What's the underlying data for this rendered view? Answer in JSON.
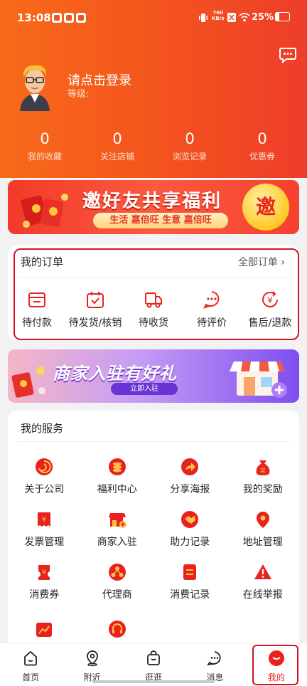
{
  "status": {
    "time": "13:08",
    "net_speed_top": "760",
    "net_speed_bottom": "KB/s",
    "battery": "25%"
  },
  "profile": {
    "login_text": "请点击登录",
    "level_label": "等级:"
  },
  "stats": [
    {
      "value": "0",
      "label": "我的收藏"
    },
    {
      "value": "0",
      "label": "关注店铺"
    },
    {
      "value": "0",
      "label": "浏览记录"
    },
    {
      "value": "0",
      "label": "优惠券"
    }
  ],
  "banner_invite": {
    "title": "邀好友共享福利",
    "subtitle": "生活 嘉倍旺  生意 嘉倍旺",
    "badge": "邀"
  },
  "orders": {
    "title": "我的订单",
    "all_label": "全部订单",
    "items": [
      {
        "label": "待付款",
        "icon": "wallet-icon"
      },
      {
        "label": "待发货/核销",
        "icon": "calendar-check-icon"
      },
      {
        "label": "待收货",
        "icon": "truck-icon"
      },
      {
        "label": "待评价",
        "icon": "chat-bubble-icon"
      },
      {
        "label": "售后/退款",
        "icon": "yen-refund-icon"
      }
    ]
  },
  "banner_merchant": {
    "title": "商家入驻有好礼",
    "button": "立即入驻"
  },
  "services": {
    "title": "我的服务",
    "items": [
      {
        "label": "关于公司",
        "icon": "swirl-icon"
      },
      {
        "label": "福利中心",
        "icon": "coins-icon"
      },
      {
        "label": "分享海报",
        "icon": "share-arrow-icon"
      },
      {
        "label": "我的奖励",
        "icon": "reward-bag-icon"
      },
      {
        "label": "发票管理",
        "icon": "invoice-icon"
      },
      {
        "label": "商家入驻",
        "icon": "storefront-icon"
      },
      {
        "label": "助力记录",
        "icon": "handshake-icon"
      },
      {
        "label": "地址管理",
        "icon": "location-pin-icon"
      },
      {
        "label": "消费券",
        "icon": "voucher-icon"
      },
      {
        "label": "代理商",
        "icon": "agent-network-icon"
      },
      {
        "label": "消费记录",
        "icon": "record-list-icon"
      },
      {
        "label": "在线举报",
        "icon": "warning-icon"
      }
    ]
  },
  "tabs": [
    {
      "label": "首页",
      "icon": "home-icon"
    },
    {
      "label": "附近",
      "icon": "location-icon"
    },
    {
      "label": "逛逛",
      "icon": "shopping-bag-icon"
    },
    {
      "label": "消息",
      "icon": "message-icon"
    },
    {
      "label": "我的",
      "icon": "profile-icon",
      "active": true
    }
  ],
  "colors": {
    "header_start": "#f86a1a",
    "header_end": "#ee3d2a",
    "accent_red": "#e8231f",
    "highlight_box": "#d3132a"
  }
}
